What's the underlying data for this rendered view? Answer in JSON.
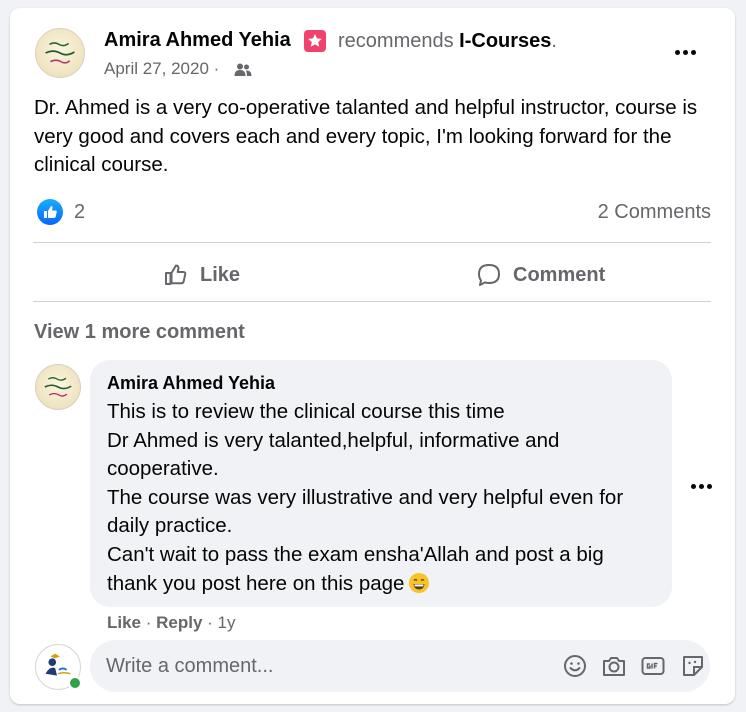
{
  "post": {
    "author": "Amira Ahmed Yehia",
    "recommends_text": "recommends",
    "page_name": "I-Courses",
    "period": ".",
    "date": "April 27, 2020 ·",
    "audience_icon": "friends-icon",
    "body": "Dr. Ahmed is a very co-operative talanted and helpful instructor, course is very good and covers each and every topic, I'm looking forward for the clinical course.",
    "reaction_icon": "thumbs-up-icon",
    "reaction_count": "2",
    "comments_count": "2 Comments"
  },
  "actions": {
    "like_label": "Like",
    "comment_label": "Comment"
  },
  "comments": {
    "view_more_label": "View 1 more comment",
    "items": [
      {
        "author": "Amira Ahmed Yehia",
        "lines": [
          "This is to review the clinical course this time",
          "Dr Ahmed is very talanted,helpful, informative and",
          "cooperative.",
          "The course was very illustrative and very helpful even for",
          "daily practice.",
          "Can't wait to pass the exam ensha'Allah and post a big",
          "thank you post here on this page"
        ],
        "emoji": "grinning-face-emoji",
        "like_label": "Like",
        "reply_label": "Reply",
        "age": "1y"
      }
    ]
  },
  "composer": {
    "placeholder": "Write a comment...",
    "tools": [
      "emoji-icon",
      "camera-icon",
      "gif-icon",
      "sticker-icon"
    ]
  },
  "colors": {
    "accent": "#0866ff",
    "secondary_text": "#65676b",
    "online": "#31a24c",
    "badge": "#f0436b"
  }
}
